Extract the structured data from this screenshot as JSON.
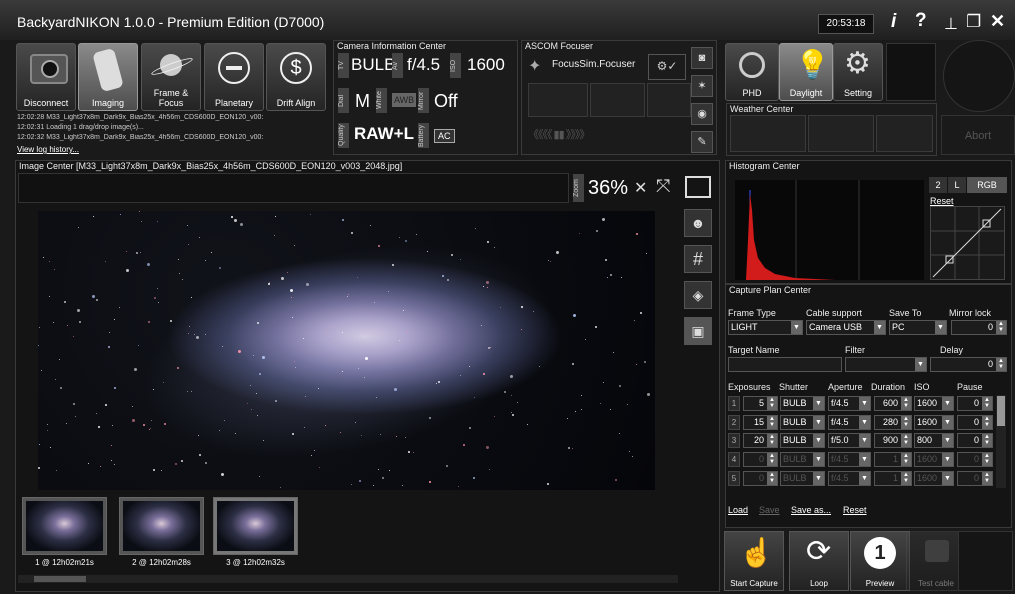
{
  "app": {
    "title": "BackyardNIKON 1.0.0 - Premium Edition (D7000)",
    "time": "20:53:18",
    "info_icon": "i",
    "help_icon": "?"
  },
  "modes": [
    {
      "label": "Disconnect",
      "icon": "camera-icon"
    },
    {
      "label": "Imaging",
      "icon": "film-icon"
    },
    {
      "label": "Frame & Focus",
      "icon": "planet-icon"
    },
    {
      "label": "Planetary",
      "icon": "planet-disk-icon"
    },
    {
      "label": "Drift Align",
      "icon": "drift-icon"
    }
  ],
  "log": {
    "lines": [
      "12:02:28  M33_Light37x8m_Dark9x_Bias25x_4h56m_CDS600D_EON120_v00:",
      "12:02:31  Loading 1 drag/drop image(s)...",
      "12:02:32  M33_Light37x8m_Dark9x_Bias25x_4h56m_CDS600D_EON120_v00:"
    ],
    "link": "View log history..."
  },
  "camera_info": {
    "title": "Camera Information Center",
    "tv_label": "TV",
    "tv": "BULB",
    "av_label": "Av",
    "av": "f/4.5",
    "iso_label": "ISO",
    "iso": "1600",
    "dial_label": "Dial",
    "dial": "M",
    "white_label": "White",
    "white": "AWB",
    "mirror_label": "Mirror",
    "mirror": "Off",
    "quality_label": "Quality",
    "quality": "RAW+L",
    "battery_label": "Battery",
    "battery": "AC"
  },
  "focuser": {
    "title": "ASCOM Focuser",
    "name": "FocusSim.Focuser"
  },
  "right_tiles": [
    {
      "label": "PHD"
    },
    {
      "label": "Daylight"
    },
    {
      "label": "Setting"
    }
  ],
  "weather": {
    "title": "Weather Center"
  },
  "abort": "Abort",
  "image_center": {
    "title": "Image Center [M33_Light37x8m_Dark9x_Bias25x_4h56m_CDS600D_EON120_v003_2048.jpg]",
    "zoom_label": "Zoom",
    "zoom": "36%"
  },
  "thumbnails": [
    "1 @ 12h02m21s",
    "2 @ 12h02m28s",
    "3 @ 12h02m32s"
  ],
  "histogram": {
    "title": "Histogram Center",
    "tabs": [
      "2",
      "L",
      "RGB"
    ],
    "reset": "Reset"
  },
  "capture_plan": {
    "title": "Capture Plan Center",
    "frame_type_label": "Frame Type",
    "frame_type": "LIGHT",
    "cable_label": "Cable support",
    "cable": "Camera USB",
    "save_to_label": "Save To",
    "save_to": "PC",
    "mirror_lock_label": "Mirror lock",
    "mirror_lock": "0",
    "target_label": "Target Name",
    "target": "",
    "filter_label": "Filter",
    "filter": "",
    "delay_label": "Delay",
    "delay": "0",
    "col_headers": [
      "Exposures",
      "Shutter",
      "Aperture",
      "Duration",
      "ISO",
      "Pause"
    ],
    "rows": [
      {
        "n": "1",
        "exp": "5",
        "shutter": "BULB",
        "aperture": "f/4.5",
        "duration": "600",
        "iso": "1600",
        "pause": "0",
        "enabled": true
      },
      {
        "n": "2",
        "exp": "15",
        "shutter": "BULB",
        "aperture": "f/4.5",
        "duration": "280",
        "iso": "1600",
        "pause": "0",
        "enabled": true
      },
      {
        "n": "3",
        "exp": "20",
        "shutter": "BULB",
        "aperture": "f/5.0",
        "duration": "900",
        "iso": "800",
        "pause": "0",
        "enabled": true
      },
      {
        "n": "4",
        "exp": "0",
        "shutter": "BULB",
        "aperture": "f/4.5",
        "duration": "1",
        "iso": "1600",
        "pause": "0",
        "enabled": false
      },
      {
        "n": "5",
        "exp": "0",
        "shutter": "BULB",
        "aperture": "f/4.5",
        "duration": "1",
        "iso": "1600",
        "pause": "0",
        "enabled": false
      }
    ],
    "links": [
      "Load",
      "Save",
      "Save as...",
      "Reset"
    ]
  },
  "actions": [
    {
      "label": "Start Capture"
    },
    {
      "label": "Loop"
    },
    {
      "label": "Preview"
    },
    {
      "label": "Test cable"
    }
  ]
}
